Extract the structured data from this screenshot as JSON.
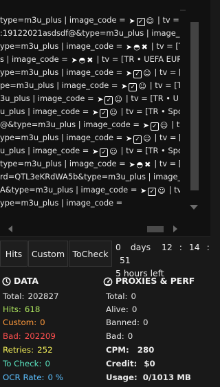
{
  "colors": {
    "hits": "#aee65f",
    "custom": "#ff9a3c",
    "bad": "#ff4f4f",
    "retries": "#f4f05a",
    "to_check": "#5ae3c0",
    "ocr_rate": "#5cc0ff"
  },
  "log": {
    "lines": [
      {
        "text": "type=m3u_plus | image_code = ",
        "glyphs": [
          "arrow-icon",
          "checkbox-icon",
          "face-icon"
        ],
        "tail": "| tv = [T"
      },
      {
        "text": ":19122021asdsdf@&type=m3u_plus | image_cod",
        "glyphs": [],
        "tail": ""
      },
      {
        "text": "ype=m3u_plus | image_code = ",
        "glyphs": [
          "arrow-icon",
          "ghost-icon",
          "cross-icon"
        ],
        "tail": "| tv = [T"
      },
      {
        "text": "s | image_code = ",
        "glyphs": [
          "arrow-icon",
          "ghost-icon",
          "cross-icon"
        ],
        "tail": "| tv = [TR • UEFA EUR"
      },
      {
        "text": "ype=m3u_plus | image_code = ",
        "glyphs": [
          "arrow-icon",
          "checkbox-icon",
          "face-icon"
        ],
        "tail": "| tv = [T"
      },
      {
        "text": "pe=m3u_plus | image_code = ",
        "glyphs": [
          "arrow-icon",
          "checkbox-icon",
          "face-icon"
        ],
        "tail": "| tv = [T"
      },
      {
        "text": "3u_plus | image_code = ",
        "glyphs": [
          "arrow-icon",
          "checkbox-icon",
          "face-icon"
        ],
        "tail": "| tv = [TR • U"
      },
      {
        "text": "u_plus | image_code = ",
        "glyphs": [
          "arrow-icon",
          "checkbox-icon",
          "face-icon"
        ],
        "tail": "| tv = [TR • Spo"
      },
      {
        "text": "@&type=m3u_plus | image_code = ",
        "glyphs": [
          "arrow-icon",
          "checkbox-icon",
          "face-icon"
        ],
        "tail": "| tv"
      },
      {
        "text": "ype=m3u_plus | image_code = ",
        "glyphs": [
          "arrow-icon",
          "checkbox-icon",
          "face-icon"
        ],
        "tail": "| tv = ["
      },
      {
        "text": "u_plus | image_code = ",
        "glyphs": [
          "arrow-icon",
          "checkbox-icon",
          "face-icon"
        ],
        "tail": "| tv = [TR • Spo"
      },
      {
        "text": "type=m3u_plus | image_code = ",
        "glyphs": [
          "arrow-icon",
          "ghost-icon",
          "cross-icon"
        ],
        "tail": "| tv = ["
      },
      {
        "text": "rd=QTL3eKRdWA5b&type=m3u_plus | image_cod",
        "glyphs": [],
        "tail": ""
      },
      {
        "text": "A&type=m3u_plus | image_code = ",
        "glyphs": [
          "arrow-icon",
          "checkbox-icon",
          "face-icon"
        ],
        "tail": "| tv"
      },
      {
        "text": "ype=m3u_plus | image_code =",
        "glyphs": [],
        "tail": ""
      }
    ]
  },
  "tabs": [
    {
      "id": "hits",
      "label": "Hits"
    },
    {
      "id": "custom",
      "label": "Custom"
    },
    {
      "id": "tocheck",
      "label": "ToCheck"
    }
  ],
  "timer": {
    "days_value": "0",
    "days_label": "days",
    "hours": "12",
    "minutes": "14",
    "seconds": "51",
    "sep": ":",
    "remaining": "5 hours left"
  },
  "data_section": {
    "title": "DATA",
    "icon": "clock-icon",
    "total": {
      "label": "Total:",
      "value": "202827"
    },
    "hits": {
      "label": "Hits:",
      "value": "618"
    },
    "custom": {
      "label": "Custom:",
      "value": "0"
    },
    "bad": {
      "label": "Bad:",
      "value": "202209"
    },
    "retries": {
      "label": "Retries:",
      "value": "252"
    },
    "to_check": {
      "label": "To Check:",
      "value": "0"
    },
    "ocr_rate": {
      "label": "OCR Rate:",
      "value": "0 %"
    }
  },
  "proxies_section": {
    "title": "PROXIES & PERF",
    "icon": "dashboard-icon",
    "total": {
      "label": "Total:",
      "value": "0"
    },
    "alive": {
      "label": "Alive:",
      "value": "0"
    },
    "banned": {
      "label": "Banned:",
      "value": "0"
    },
    "bad": {
      "label": "Bad:",
      "value": "0"
    },
    "cpm": {
      "label": "CPM:",
      "value": "280"
    },
    "credit": {
      "label": "Credit:",
      "value": "$0"
    },
    "usage": {
      "label": "Usage:",
      "value": "0/1013 MB"
    }
  }
}
